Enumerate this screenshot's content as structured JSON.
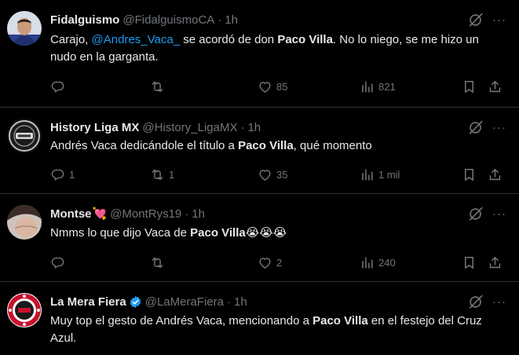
{
  "tweets": [
    {
      "name": "Fidalguismo",
      "handle": "@FidalguismoCA",
      "dot": "·",
      "time": "1h",
      "text_before_mention": "Carajo, ",
      "mention": "@Andres_Vaca_",
      "text_after_mention": " se acordó de don ",
      "bold": "Paco Villa",
      "text_end": ". No lo niego, se me hizo un nudo en la garganta.",
      "replies": "",
      "retweets": "",
      "likes": "85",
      "views": "821"
    },
    {
      "name": "History Liga MX",
      "handle": "@History_LigaMX",
      "dot": "·",
      "time": "1h",
      "text_before": "Andrés Vaca dedicándole el título a ",
      "bold": "Paco Villa",
      "text_after": ", qué momento",
      "replies": "1",
      "retweets": "1",
      "likes": "35",
      "views": "1 mil"
    },
    {
      "name": "Montse",
      "name_emoji": "💘",
      "handle": "@MontRys19",
      "dot": "·",
      "time": "1h",
      "text_before": "Nmms lo que dijo Vaca de ",
      "bold": "Paco Villa",
      "emojis": "😭😭😭",
      "replies": "",
      "retweets": "",
      "likes": "2",
      "views": "240"
    },
    {
      "name": "La Mera Fiera",
      "handle": "@LaMeraFiera",
      "dot": "·",
      "time": "1h",
      "text_before": "Muy top el gesto de Andrés Vaca, mencionando a ",
      "bold": "Paco Villa",
      "text_after": " en el festejo del Cruz Azul."
    }
  ],
  "more_label": "···",
  "icons": {
    "reply": "reply-icon",
    "retweet": "retweet-icon",
    "like": "heart-icon",
    "views": "views-icon",
    "bookmark": "bookmark-icon",
    "share": "share-icon",
    "grok": "grok-icon",
    "verified": "verified-badge-icon"
  },
  "colors": {
    "background": "#000000",
    "text": "#e7e9ea",
    "muted": "#71767b",
    "link": "#1d9bf0",
    "divider": "#2f3336"
  }
}
